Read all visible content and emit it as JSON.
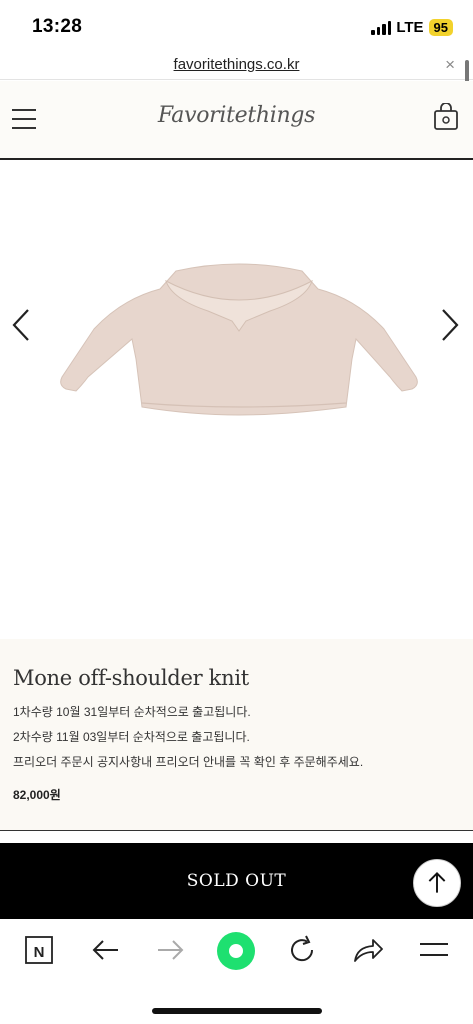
{
  "status": {
    "time": "13:28",
    "network": "LTE",
    "battery": "95"
  },
  "browser": {
    "url": "favoritethings.co.kr",
    "close_glyph": "×"
  },
  "header": {
    "logo": "Favoritethings",
    "menu_icon": "hamburger-menu-icon",
    "bag_icon": "shopping-bag-icon"
  },
  "gallery": {
    "prev_icon": "chevron-left-icon",
    "next_icon": "chevron-right-icon",
    "image": "pink-off-shoulder-knit-sweater"
  },
  "product": {
    "title": "Mone off-shoulder knit",
    "notice_1": "1차수량 10월 31일부터 순차적으로 출고됩니다.",
    "notice_2": "2차수량 11월 03일부터 순차적으로 출고됩니다.",
    "notice_3": "프리오더 주문시 공지사항내 프리오더 안내를 꼭 확인 후 주문해주세요.",
    "price": "82,000원"
  },
  "purchase": {
    "sold_out_label": "SOLD OUT",
    "top_icon": "arrow-up-icon"
  },
  "toolbar": {
    "items": [
      "naver-home-icon",
      "back-arrow-icon",
      "forward-arrow-icon",
      "green-search-icon",
      "refresh-icon",
      "share-icon",
      "menu-icon"
    ]
  },
  "colors": {
    "header_bg": "#fcfbf8",
    "info_bg": "#fbf9f4",
    "soldout_bg": "#000000",
    "green": "#1ee070"
  }
}
